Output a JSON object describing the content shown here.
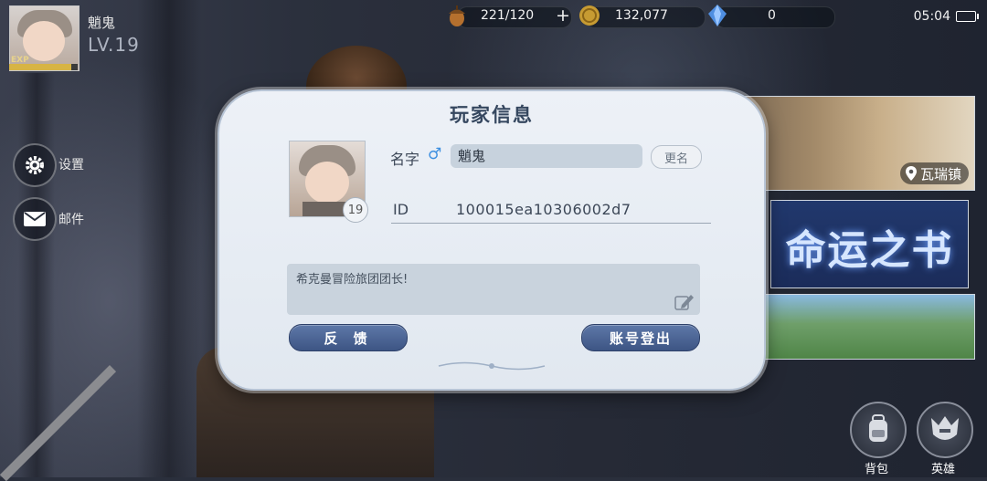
{
  "player": {
    "name": "魈鬼",
    "level_text": "LV.19",
    "exp_label": "EXP",
    "exp_progress": 0.9
  },
  "side_menu": [
    {
      "label": "设置",
      "icon": "gear-icon"
    },
    {
      "label": "邮件",
      "icon": "mail-icon"
    }
  ],
  "resources": {
    "stamina": {
      "value": "221/120",
      "icon": "acorn-icon",
      "add_label": "+"
    },
    "gold": {
      "value": "132,077",
      "icon": "gold-coin-icon"
    },
    "gems": {
      "value": "0",
      "icon": "blue-crystal-icon"
    }
  },
  "status": {
    "time": "05:04"
  },
  "banners": {
    "location": "瓦瑞镇",
    "book_of_fate": "命运之书"
  },
  "bottom_buttons": [
    {
      "label": "背包",
      "icon": "backpack-icon"
    },
    {
      "label": "英雄",
      "icon": "hero-helmet-icon"
    }
  ],
  "dialog": {
    "title": "玩家信息",
    "name_label": "名字",
    "gender_symbol": "♂",
    "name_value": "魈鬼",
    "rename_label": "更名",
    "id_label": "ID",
    "id_value": "100015ea10306002d7",
    "avatar_level": "19",
    "signature": "希克曼冒险旅团团长!",
    "feedback_label": "反 馈",
    "logout_label": "账号登出"
  },
  "colors": {
    "dialog_bg": "#e5ebf2",
    "button_blue": "#4a6394",
    "exp_bar": "#d7b444",
    "gender_blue": "#3d8fe0"
  }
}
